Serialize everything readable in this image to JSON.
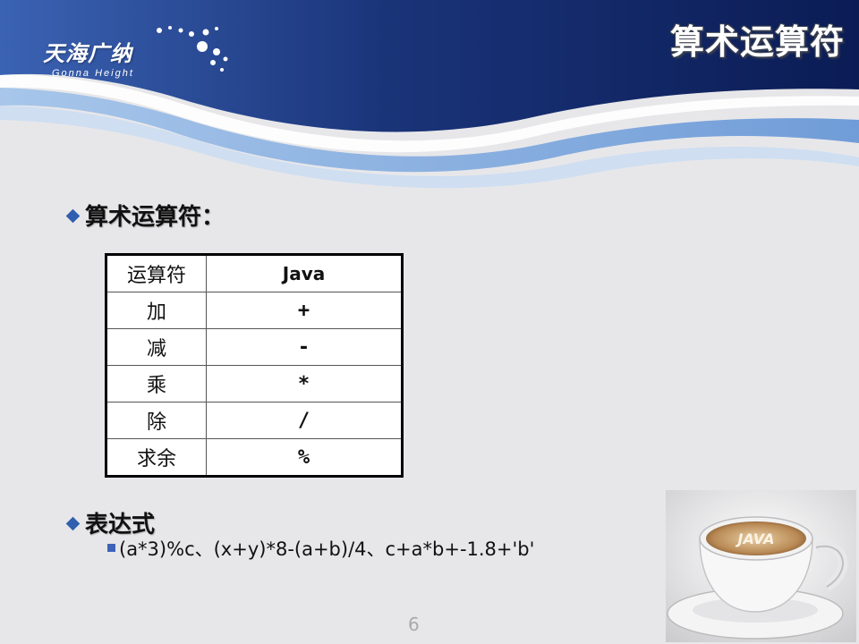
{
  "header": {
    "logo_cn": "天海广纳",
    "logo_en": "Gonna Height",
    "slide_title": "算术运算符"
  },
  "section1": {
    "heading": "算术运算符："
  },
  "table": {
    "headers": [
      "运算符",
      "Java"
    ],
    "rows": [
      [
        "加",
        "+"
      ],
      [
        "减",
        "-"
      ],
      [
        "乘",
        "*"
      ],
      [
        "除",
        "/"
      ],
      [
        "求余",
        "%"
      ]
    ]
  },
  "section2": {
    "heading": "表达式",
    "sub_item": "(a*3)%c、(x+y)*8-(a+b)/4、c+a*b+-1.8+'b'"
  },
  "photo": {
    "cup_text": "JAVA"
  },
  "page_number": "6",
  "colors": {
    "header_dark": "#0e1f5e",
    "header_mid": "#2b4f9e",
    "accent_blue": "#2f5fae"
  }
}
